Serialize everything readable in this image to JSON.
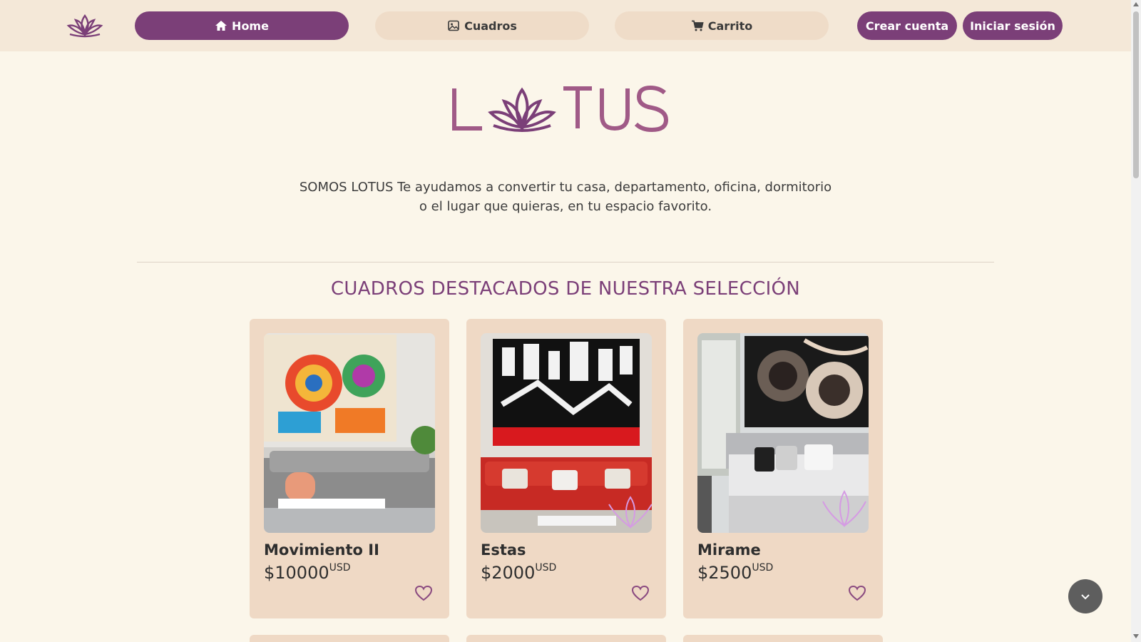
{
  "nav": {
    "home_label": "Home",
    "paintings_label": "Cuadros",
    "cart_label": "Carrito",
    "create_account_label": "Crear cuenta",
    "login_label": "Iniciar sesión",
    "icons": [
      "lotus-icon",
      "home-icon",
      "image-icon",
      "cart-icon"
    ]
  },
  "hero": {
    "logo_text": "LOTUS",
    "tagline_line1": "SOMOS LOTUS Te ayudamos a convertir tu casa, departamento, oficina, dormitorio",
    "tagline_line2": "o el lugar que quieras, en tu espacio favorito."
  },
  "featured": {
    "title": "CUADROS DESTACADOS DE NUESTRA SELECCIÓN",
    "items": [
      {
        "name": "Movimiento II",
        "price": "$10000",
        "currency": "USD"
      },
      {
        "name": "Estas",
        "price": "$2000",
        "currency": "USD"
      },
      {
        "name": "Mirame",
        "price": "$2500",
        "currency": "USD"
      }
    ]
  },
  "colors": {
    "accent": "#7b3f78",
    "nav_bg": "#f4e8d8",
    "page_bg": "#fbf6ea",
    "card_bg": "#efd9c5"
  }
}
